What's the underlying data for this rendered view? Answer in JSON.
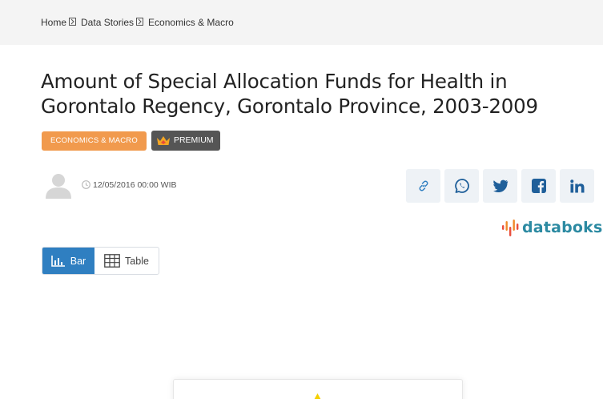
{
  "breadcrumb": {
    "items": [
      "Home",
      "Data Stories",
      "Economics & Macro"
    ]
  },
  "article": {
    "title_line1": "Amount of Special Allocation Funds for Health in",
    "title_line2": "Gorontalo Regency, Gorontalo Province, 2003-2009",
    "category_badge": "ECONOMICS & MACRO",
    "premium_badge": "PREMIUM",
    "date": "12/05/2016 00:00 WIB"
  },
  "share": {
    "icons": [
      "link-icon",
      "whatsapp-icon",
      "twitter-icon",
      "facebook-icon",
      "linkedin-icon"
    ]
  },
  "brand": {
    "logo_text": "databoks",
    "color": "#2c8aa2"
  },
  "view_toggle": {
    "bar_label": "Bar",
    "table_label": "Table",
    "active": "Bar"
  },
  "colors": {
    "category_badge": "#f19a4d",
    "premium_badge": "#555555",
    "toggle_active": "#2f7fc1",
    "chart_marker": "#f5d000"
  }
}
